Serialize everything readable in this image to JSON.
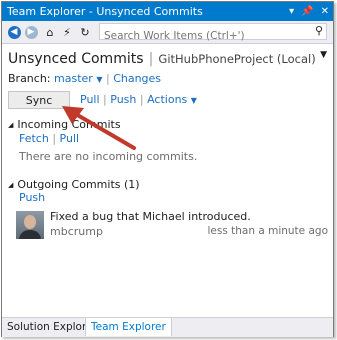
{
  "window": {
    "title": "Team Explorer - Unsynced Commits"
  },
  "toolbar": {
    "search_placeholder": "Search Work Items (Ctrl+')"
  },
  "header": {
    "title": "Unsynced Commits",
    "separator": "|",
    "project": "GitHubPhoneProject (Local)"
  },
  "branch": {
    "label": "Branch:",
    "value": "master",
    "changes_link": "Changes"
  },
  "actions": {
    "sync_label": "Sync",
    "pull_label": "Pull",
    "push_label": "Push",
    "actions_label": "Actions"
  },
  "incoming": {
    "title": "Incoming Commits",
    "fetch_label": "Fetch",
    "pull_label": "Pull",
    "empty_message": "There are no incoming commits."
  },
  "outgoing": {
    "title": "Outgoing Commits (1)",
    "push_label": "Push",
    "commits": [
      {
        "message": "Fixed a bug that Michael introduced.",
        "author": "mbcrump",
        "time": "less than a minute ago"
      }
    ]
  },
  "bottom_tabs": [
    {
      "label": "Solution Explorer",
      "active": false
    },
    {
      "label": "Team Explorer",
      "active": true
    }
  ],
  "colors": {
    "accent": "#007acc",
    "link": "#1e6fbf",
    "annotation_arrow": "#c0392b"
  },
  "icons": [
    "back-arrow-icon",
    "forward-arrow-icon",
    "home-icon",
    "plug-icon",
    "refresh-icon",
    "search-icon",
    "dropdown-icon",
    "pin-icon",
    "close-icon"
  ]
}
